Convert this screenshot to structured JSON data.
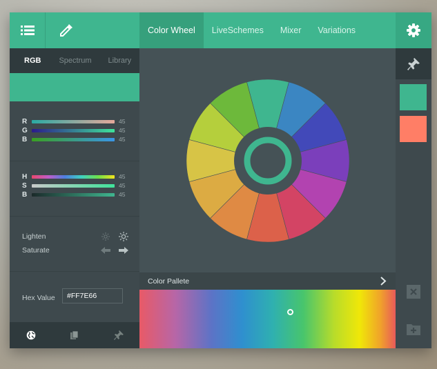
{
  "toolbar": {
    "menu_icon": "hamburger-menu-icon",
    "eyedropper_icon": "eyedropper-icon",
    "settings_icon": "gear-icon"
  },
  "tabs": [
    {
      "label": "Color Wheel",
      "active": true
    },
    {
      "label": "LiveSchemes",
      "active": false
    },
    {
      "label": "Mixer",
      "active": false
    },
    {
      "label": "Variations",
      "active": false
    }
  ],
  "left_panel": {
    "subtabs": [
      {
        "label": "RGB",
        "active": true
      },
      {
        "label": "Spectrum",
        "active": false
      },
      {
        "label": "Library",
        "active": false
      }
    ],
    "selected_color": "#3FB68F",
    "rgb": [
      {
        "label": "R",
        "value": "45"
      },
      {
        "label": "G",
        "value": "45"
      },
      {
        "label": "B",
        "value": "45"
      }
    ],
    "hsb": [
      {
        "label": "H",
        "value": "45"
      },
      {
        "label": "S",
        "value": "45"
      },
      {
        "label": "B",
        "value": "45"
      }
    ],
    "adjust": [
      {
        "label": "Lighten",
        "icons": [
          "sun-dim-icon",
          "sun-bright-icon"
        ]
      },
      {
        "label": "Saturate",
        "icons": [
          "arrow-left-icon",
          "arrow-right-icon"
        ]
      }
    ],
    "hex": {
      "label": "Hex Value",
      "value": "#FF7E66"
    },
    "footer_icons": [
      "globe-icon",
      "copy-icon",
      "pin-icon"
    ]
  },
  "palette": {
    "title": "Color Pallete"
  },
  "right_rail": {
    "swatches": [
      "#3FB68F",
      "#FF7E66"
    ],
    "icons": [
      "pin-icon",
      "close-icon",
      "add-folder-icon"
    ]
  },
  "colors": {
    "accent": "#3FB68F",
    "panel": "#455256",
    "dark": "#2F3A3D"
  }
}
